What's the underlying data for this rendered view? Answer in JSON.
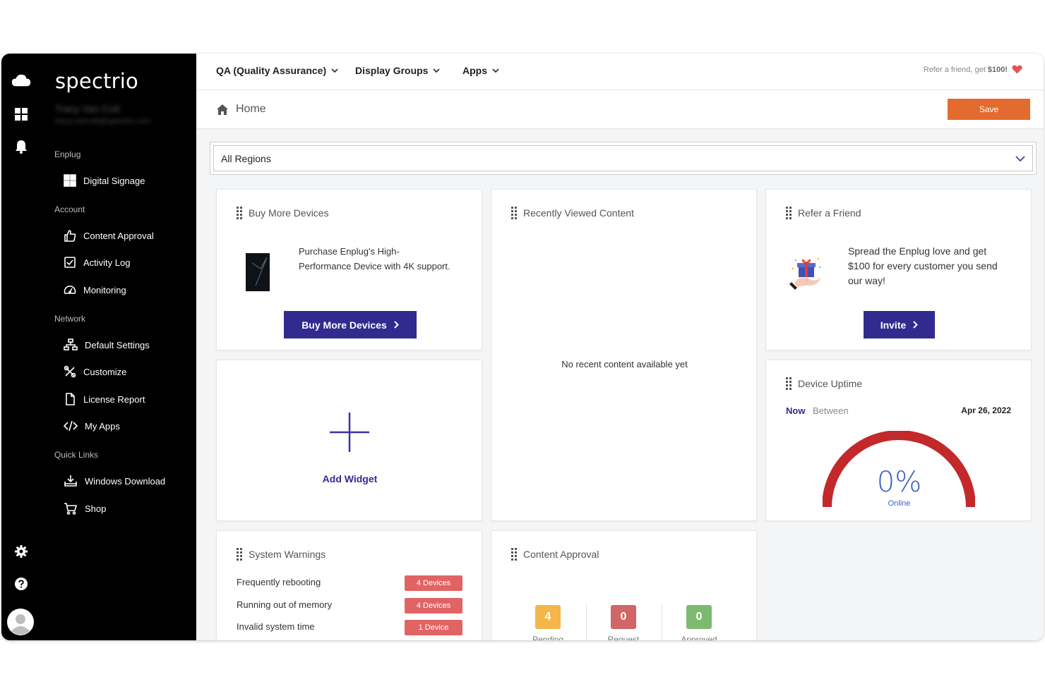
{
  "sidebar": {
    "logo": "spectrio",
    "user_name": "Tracy Van Cott",
    "user_email": "tracy.vancott@spectrio.com",
    "sections": {
      "enplug": "Enplug",
      "account": "Account",
      "network": "Network",
      "quick_links": "Quick Links"
    },
    "items": {
      "digital_signage": "Digital Signage",
      "content_approval": "Content Approval",
      "activity_log": "Activity Log",
      "monitoring": "Monitoring",
      "default_settings": "Default Settings",
      "customize": "Customize",
      "license_report": "License Report",
      "my_apps": "My Apps",
      "windows_download": "Windows Download",
      "shop": "Shop"
    }
  },
  "topbar": {
    "menus": [
      "QA (Quality Assurance)",
      "Display Groups",
      "Apps"
    ],
    "refer_prefix": "Refer a friend, get ",
    "refer_amount": "$100!"
  },
  "subbar": {
    "breadcrumb": "Home",
    "save_label": "Save"
  },
  "region": {
    "selected": "All Regions"
  },
  "buy": {
    "title": "Buy More Devices",
    "description": "Purchase Enplug's High-Performance Device with 4K support.",
    "button": "Buy More Devices"
  },
  "recent": {
    "title": "Recently Viewed Content",
    "empty": "No recent content available yet"
  },
  "refer": {
    "title": "Refer a Friend",
    "description": "Spread the Enplug love and get $100 for every customer you send our way!",
    "button": "Invite"
  },
  "widget": {
    "label": "Add Widget"
  },
  "uptime": {
    "title": "Device Uptime",
    "tab_now": "Now",
    "tab_between": "Between",
    "date": "Apr 26, 2022",
    "value": "0%",
    "value_label": "Online",
    "online_fraction": 0
  },
  "warnings": {
    "title": "System Warnings",
    "rows": [
      {
        "label": "Frequently rebooting",
        "badge": "4 Devices"
      },
      {
        "label": "Running out of memory",
        "badge": "4 Devices"
      },
      {
        "label": "Invalid system time",
        "badge": "1 Device"
      }
    ]
  },
  "approval": {
    "title": "Content Approval",
    "stats": [
      {
        "value": "4",
        "label": "Pending",
        "color": "#f4b64a"
      },
      {
        "value": "0",
        "label": "Request",
        "color": "#d26565"
      },
      {
        "value": "0",
        "label": "Approved",
        "color": "#7dba6f"
      }
    ]
  },
  "colors": {
    "accent": "#312a8f",
    "save": "#e36b30",
    "gauge": "#c3282b",
    "badge": "#e16464"
  }
}
